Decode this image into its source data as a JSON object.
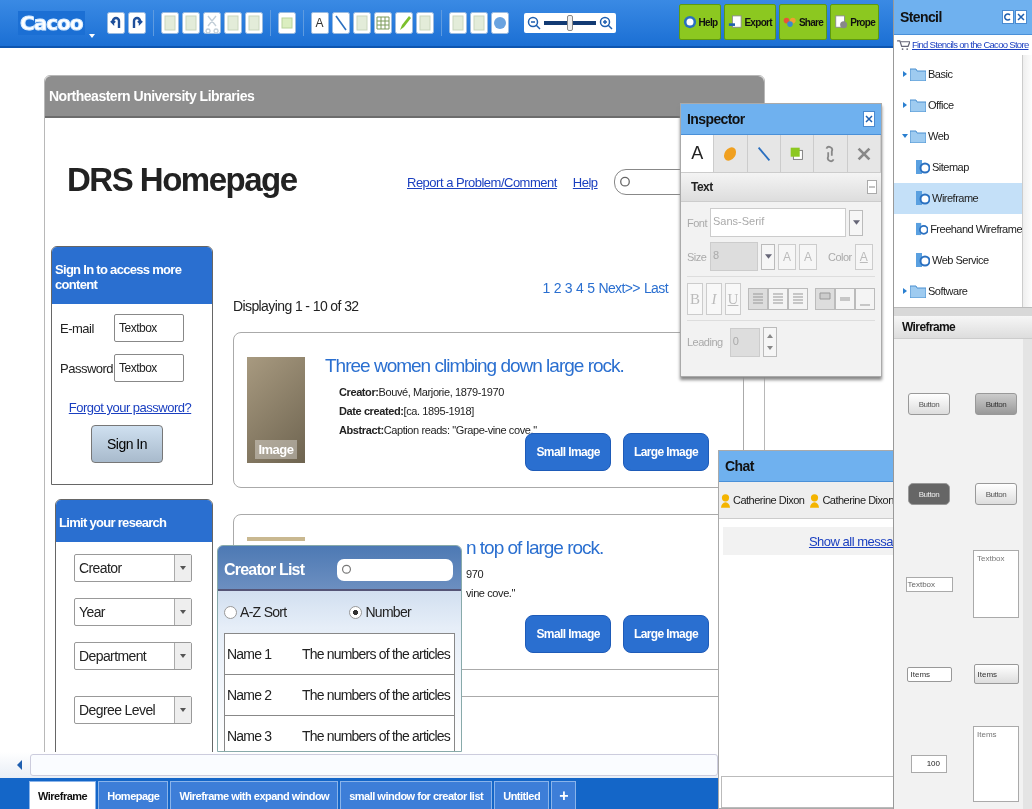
{
  "toolbar": {
    "logo": "Cacoo",
    "text_tool": "A",
    "zoom": {
      "level": 0.5
    },
    "buttons": [
      {
        "kind": "help",
        "label": "Help"
      },
      {
        "kind": "export",
        "label": "Export"
      },
      {
        "kind": "share",
        "label": "Share"
      },
      {
        "kind": "properties",
        "label": "Prope"
      }
    ]
  },
  "page": {
    "header": "Northeastern University Libraries",
    "title": "DRS Homepage",
    "links": [
      "Report a Problem/Comment",
      "Help"
    ],
    "signin": {
      "title": "Sign In to access more content",
      "fields": [
        {
          "label": "E-mail",
          "value": "Textbox"
        },
        {
          "label": "Password",
          "value": "Textbox"
        }
      ],
      "forgot": "Forgot your password?",
      "button": "Sign In"
    },
    "filters": {
      "title": "Limit your research",
      "dropdowns": [
        "Creator",
        "Year",
        "Department",
        "Degree Level"
      ]
    },
    "summary": "Displaying 1 - 10 of 32",
    "pagination": [
      "1",
      "2",
      "3",
      "4",
      "5",
      "Next>>",
      "Last"
    ],
    "results": [
      {
        "title": "Three women climbing down large rock.",
        "image_label": "Image",
        "lines": [
          {
            "label": "Creator:",
            "value": "Bouvé, Marjorie, 1879-1970"
          },
          {
            "label": "Date created:",
            "value": "[ca. 1895-1918]"
          },
          {
            "label": "Abstract:",
            "value": "Caption reads: \"Grape-vine cove.\""
          }
        ],
        "buttons": [
          "Small Image",
          "Large Image"
        ]
      },
      {
        "title": "n top of large rock.",
        "lines": [
          {
            "value": "970"
          },
          {
            "value": "vine cove.\""
          }
        ],
        "buttons": [
          "Small Image",
          "Large Image"
        ]
      }
    ]
  },
  "inspector": {
    "title": "Inspector",
    "tabs": [
      {
        "kind": "text",
        "label": "A",
        "selected": true
      },
      {
        "kind": "fill",
        "selected": false
      },
      {
        "kind": "line",
        "selected": false
      },
      {
        "kind": "shadow",
        "selected": false
      },
      {
        "kind": "link",
        "selected": false
      },
      {
        "kind": "tools",
        "selected": false
      }
    ],
    "section": "Text",
    "font_label": "Font",
    "font_value": "Sans-Serif",
    "size_label": "Size",
    "size_value": "8",
    "grow": "A",
    "shrink": "A",
    "color_label": "Color",
    "color_glyph": "A",
    "style_buttons": [
      "B",
      "I",
      "U"
    ],
    "leading_label": "Leading",
    "leading_value": "0"
  },
  "chat": {
    "title": "Chat",
    "users": [
      "Catherine Dixon",
      "Catherine Dixon"
    ],
    "show_all": "Show all messa"
  },
  "creator_list": {
    "title": "Creator List",
    "radios": [
      {
        "label": "A-Z Sort",
        "selected": false
      },
      {
        "label": "Number",
        "selected": true
      }
    ],
    "rows": [
      {
        "name": "Name 1",
        "count": "The numbers of the articles"
      },
      {
        "name": "Name 2",
        "count": "The numbers of the articles"
      },
      {
        "name": "Name 3",
        "count": "The numbers of the articles"
      }
    ]
  },
  "stencil": {
    "title": "Stencil",
    "store_link": "Find Stencils on the Cacoo Store",
    "tree": [
      {
        "label": "Basic",
        "expanded": false
      },
      {
        "label": "Office",
        "expanded": false
      },
      {
        "label": "Web",
        "expanded": true,
        "children": [
          {
            "label": "Sitemap",
            "selected": false
          },
          {
            "label": "Wireframe",
            "selected": true
          },
          {
            "label": "Freehand Wireframe",
            "selected": false
          },
          {
            "label": "Web Service",
            "selected": false
          }
        ]
      },
      {
        "label": "Software",
        "expanded": false
      }
    ],
    "palette_title": "Wireframe",
    "palette": [
      {
        "kind": "button",
        "label": "Button"
      },
      {
        "kind": "button-pressed",
        "label": "Button"
      },
      {
        "kind": "button-dark",
        "label": "Button"
      },
      {
        "kind": "button",
        "label": "Button"
      },
      {
        "kind": "textbox",
        "label": "Textbox"
      },
      {
        "kind": "textarea",
        "label": "Textbox"
      },
      {
        "kind": "select-small",
        "label": "Items"
      },
      {
        "kind": "select",
        "label": "Items"
      },
      {
        "kind": "spinner",
        "label": "100"
      },
      {
        "kind": "listbox",
        "label": "Items"
      }
    ]
  },
  "tabs": [
    {
      "label": "Wireframe",
      "selected": true
    },
    {
      "label": "Homepage",
      "selected": false
    },
    {
      "label": "Wireframe with expand window",
      "selected": false
    },
    {
      "label": "small window for creator list",
      "selected": false
    },
    {
      "label": "Untitled",
      "selected": false
    }
  ],
  "add_tab": "+"
}
